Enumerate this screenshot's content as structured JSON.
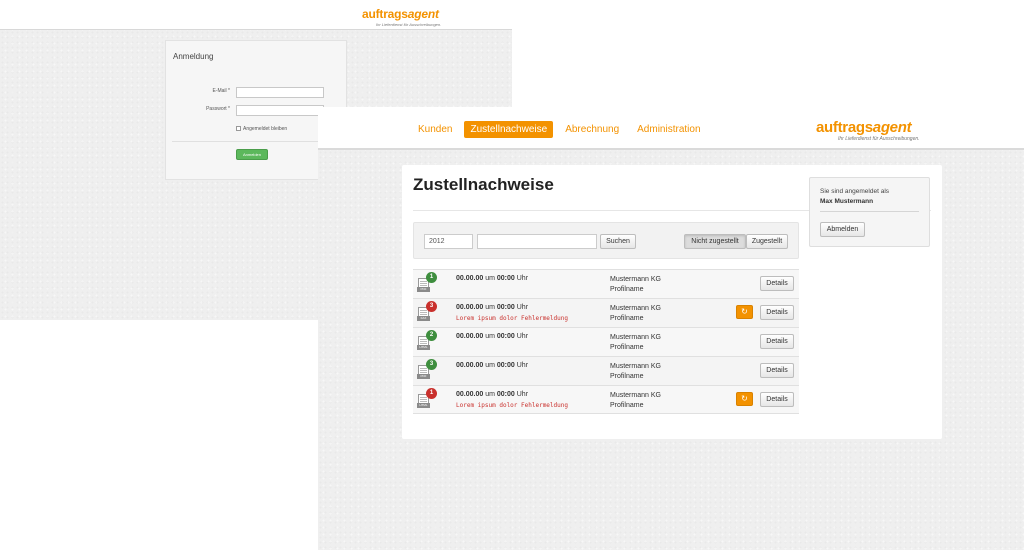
{
  "login": {
    "logo": {
      "word_a": "auftrags",
      "word_b": "agent",
      "tagline": "Ihr Lieferdienst für Ausschreibungen."
    },
    "title": "Anmeldung",
    "email_label": "E-Mail *",
    "email_value": "",
    "password_label": "Passwort *",
    "password_value": "",
    "remember_label": "Angemeldet bleiben",
    "submit_label": "Anmelden"
  },
  "main": {
    "nav": [
      "Kunden",
      "Zustellnachweise",
      "Abrechnung",
      "Administration"
    ],
    "active_nav": "Zustellnachweise",
    "logo": {
      "word_a": "auftrags",
      "word_b": "agent",
      "tagline": "Ihr Lieferdienst für Ausschreibungen."
    },
    "page_title": "Zustellnachweise",
    "search": {
      "year_value": "2012",
      "query_value": "",
      "search_button": "Suchen",
      "filter_not_delivered": "Nicht zugestellt",
      "filter_delivered": "Zugestellt"
    },
    "rows": [
      {
        "badge": "1",
        "badge_color": "#3e8e3e",
        "doc_type": "PDF",
        "date": "00.00.00",
        "sep": "um",
        "time": "00:00",
        "unit": "Uhr",
        "error": "",
        "customer": "Mustermann KG",
        "profile": "Profilname",
        "retry": false,
        "details": "Details"
      },
      {
        "badge": "3",
        "badge_color": "#c9302c",
        "doc_type": "FAX",
        "date": "00.00.00",
        "sep": "um",
        "time": "00:00",
        "unit": "Uhr",
        "error": "Lorem ipsum dolor Fehlermeldung",
        "customer": "Mustermann KG",
        "profile": "Profilname",
        "retry": true,
        "details": "Details"
      },
      {
        "badge": "2",
        "badge_color": "#3e8e3e",
        "doc_type": "HTML",
        "date": "00.00.00",
        "sep": "um",
        "time": "00:00",
        "unit": "Uhr",
        "error": "",
        "customer": "Mustermann KG",
        "profile": "Profilname",
        "retry": false,
        "details": "Details"
      },
      {
        "badge": "3",
        "badge_color": "#3e8e3e",
        "doc_type": "PDF",
        "date": "00.00.00",
        "sep": "um",
        "time": "00:00",
        "unit": "Uhr",
        "error": "",
        "customer": "Mustermann KG",
        "profile": "Profilname",
        "retry": false,
        "details": "Details"
      },
      {
        "badge": "1",
        "badge_color": "#c9302c",
        "doc_type": "HTML",
        "date": "00.00.00",
        "sep": "um",
        "time": "00:00",
        "unit": "Uhr",
        "error": "Lorem ipsum dolor Fehlermeldung",
        "customer": "Mustermann KG",
        "profile": "Profilname",
        "retry": true,
        "details": "Details"
      }
    ],
    "sidebar": {
      "logged_in_text": "Sie sind angemeldet als",
      "user_name": "Max Mustermann",
      "logout_button": "Abmelden"
    }
  },
  "colors": {
    "accent": "#f39200",
    "success": "#5cb85c",
    "danger": "#c9302c",
    "badge_green": "#3e8e3e"
  }
}
